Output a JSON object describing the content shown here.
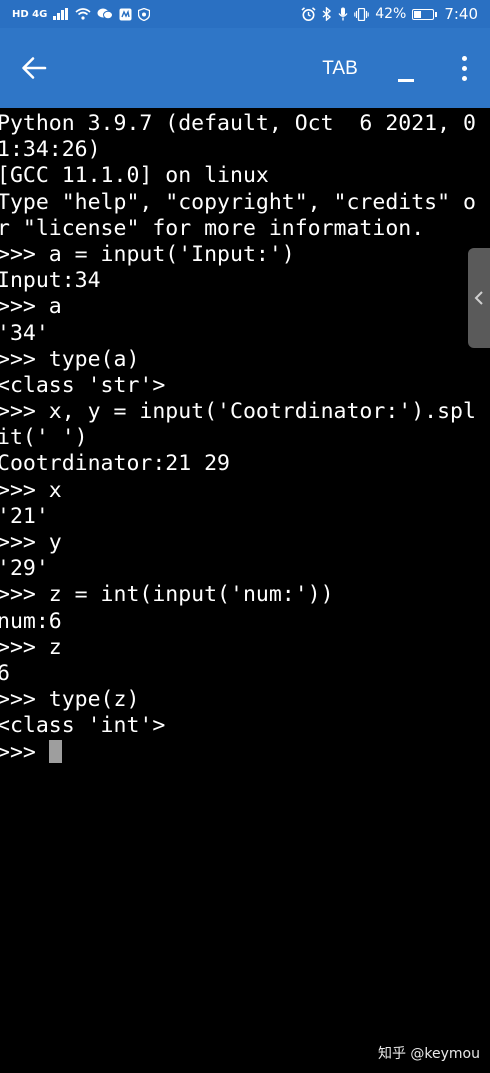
{
  "status_bar": {
    "network": "HD 4G",
    "battery_percent": "42%",
    "battery_level": 0.42,
    "time": "7:40"
  },
  "app_bar": {
    "tab_label": "TAB"
  },
  "terminal": {
    "lines": [
      "Python 3.9.7 (default, Oct  6 2021, 0",
      "1:34:26)",
      "[GCC 11.1.0] on linux",
      "Type \"help\", \"copyright\", \"credits\" o",
      "r \"license\" for more information.",
      ">>> a = input('Input:')",
      "Input:34",
      ">>> a",
      "'34'",
      ">>> type(a)",
      "<class 'str'>",
      ">>> x, y = input('Cootrdinator:').spl",
      "it(' ')",
      "Cootrdinator:21 29",
      ">>> x",
      "'21'",
      ">>> y",
      "'29'",
      ">>> z = int(input('num:'))",
      "num:6",
      ">>> z",
      "6",
      ">>> type(z)",
      "<class 'int'>"
    ],
    "prompt": ">>> "
  },
  "watermark": "知乎 @keymou"
}
